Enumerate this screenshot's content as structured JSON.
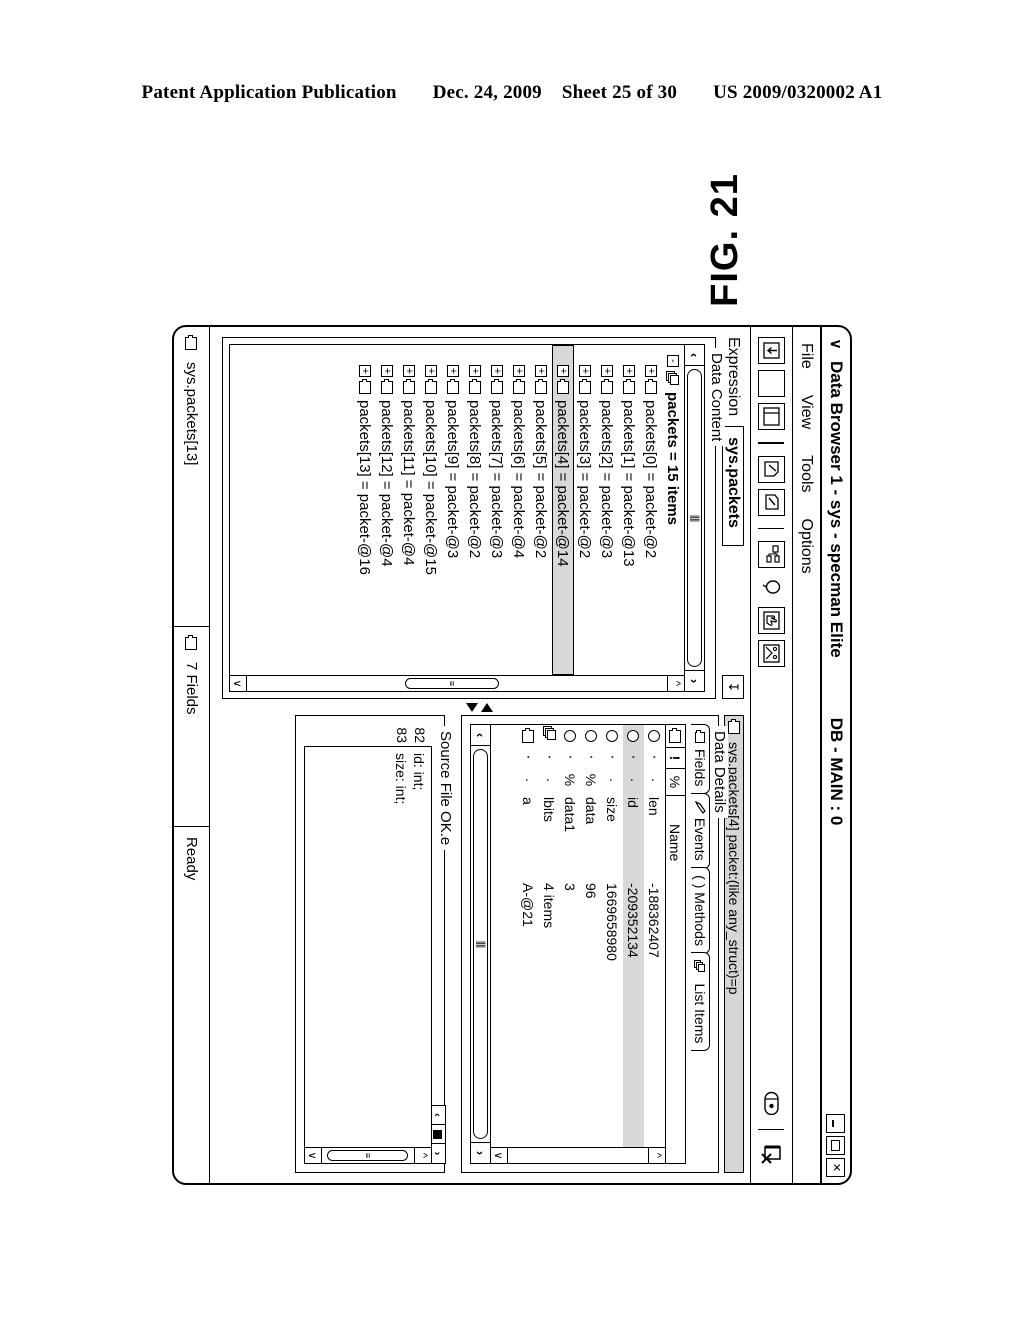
{
  "patent_header": {
    "publication": "Patent Application Publication",
    "date": "Dec. 24, 2009",
    "sheet": "Sheet 25 of 30",
    "number": "US 2009/0320002 A1"
  },
  "figure_label": "FIG. 21",
  "window": {
    "title": "Data Browser 1 - sys - specman Elite",
    "subtitle": "DB - MAIN : 0",
    "sysmenu_glyph": "∨",
    "buttons": [
      {
        "name": "minimize-button",
        "label": "_"
      },
      {
        "name": "maximize-button",
        "label": "□"
      },
      {
        "name": "close-button",
        "label": "✕"
      }
    ]
  },
  "menubar": {
    "items": [
      "File",
      "View",
      "Tools",
      "Options"
    ]
  },
  "toolbar": {
    "icons": [
      "import-down-icon",
      "blank-page-icon",
      "split-page-icon",
      "edit-page-icon",
      "hierarchy-tree-icon",
      "balloon-icon",
      "hand-pointer-icon",
      "graph-icon"
    ],
    "right_icons": [
      "close-document-icon",
      "toggle-switch-icon"
    ]
  },
  "data_content": {
    "expression_label": "Expression",
    "expression_value": "sys.packets",
    "expression_button": "↧",
    "legend": "Data Content",
    "hscroll_thumb": "||||",
    "root": {
      "expander": "-",
      "label": "packets  =  15 items"
    },
    "items": [
      {
        "expander": "+",
        "label": "packets[0]  =  packet-@2",
        "selected": false
      },
      {
        "expander": "+",
        "label": "packets[1]  =  packet-@13",
        "selected": false
      },
      {
        "expander": "+",
        "label": "packets[2]  =  packet-@3",
        "selected": false
      },
      {
        "expander": "+",
        "label": "packets[3]  =  packet-@2",
        "selected": false
      },
      {
        "expander": "+",
        "label": "packets[4]  =  packet-@14",
        "selected": true
      },
      {
        "expander": "+",
        "label": "packets[5]  =  packet-@2",
        "selected": false
      },
      {
        "expander": "+",
        "label": "packets[6]  =  packet-@4",
        "selected": false
      },
      {
        "expander": "+",
        "label": "packets[7]  =  packet-@3",
        "selected": false
      },
      {
        "expander": "+",
        "label": "packets[8]  =  packet-@2",
        "selected": false
      },
      {
        "expander": "+",
        "label": "packets[9]  =  packet-@3",
        "selected": false
      },
      {
        "expander": "+",
        "label": "packets[10] =  packet-@15",
        "selected": false
      },
      {
        "expander": "+",
        "label": "packets[11] =  packet-@4",
        "selected": false
      },
      {
        "expander": "+",
        "label": "packets[12] =  packet-@4",
        "selected": false
      },
      {
        "expander": "+",
        "label": "packets[13] =  packet-@16",
        "selected": false
      }
    ]
  },
  "data_details": {
    "header_text": "sys.packets[4]  packet:(like any_struct)=p",
    "legend": "Data Details",
    "tabs": [
      {
        "label": "Fields",
        "icon": "struct-icon",
        "active": true
      },
      {
        "label": "Events",
        "icon": "pencil-icon",
        "active": false
      },
      {
        "label": "( ) Methods",
        "icon": "none",
        "active": false
      },
      {
        "label": "List Items",
        "icon": "list-icon",
        "active": false
      }
    ],
    "columns": [
      "!",
      "%",
      "Name"
    ],
    "rows": [
      {
        "icon": "scalar-icon",
        "excl": "·",
        "pct": "·",
        "name": "len",
        "value": "-188362407",
        "selected": false
      },
      {
        "icon": "scalar-icon",
        "excl": "·",
        "pct": "·",
        "name": "id",
        "value": "-209352134",
        "selected": true
      },
      {
        "icon": "scalar-icon",
        "excl": "·",
        "pct": "·",
        "name": "size",
        "value": "1669658980",
        "selected": false
      },
      {
        "icon": "scalar-icon",
        "excl": "·",
        "pct": "%",
        "name": "data",
        "value": "96",
        "selected": false
      },
      {
        "icon": "scalar-icon",
        "excl": "·",
        "pct": "%",
        "name": "data1",
        "value": "3",
        "selected": false
      },
      {
        "icon": "list-icon",
        "excl": "·",
        "pct": "·",
        "name": "lbits",
        "value": "4 items",
        "selected": false
      },
      {
        "icon": "struct-icon",
        "excl": "·",
        "pct": "·",
        "name": "a",
        "value": "A-@21",
        "selected": false
      }
    ],
    "hscroll_thumb": "||||"
  },
  "source_file": {
    "legend": "Source File OK.e",
    "lines": [
      {
        "number": "82",
        "code": "id: int;"
      },
      {
        "number": "83",
        "code": "size: int;"
      }
    ],
    "scroll_buttons": [
      "‹",
      "■",
      "›"
    ]
  },
  "statusbar": {
    "selection": "sys.packets[13]",
    "fields": "7 Fields",
    "state": "Ready"
  }
}
